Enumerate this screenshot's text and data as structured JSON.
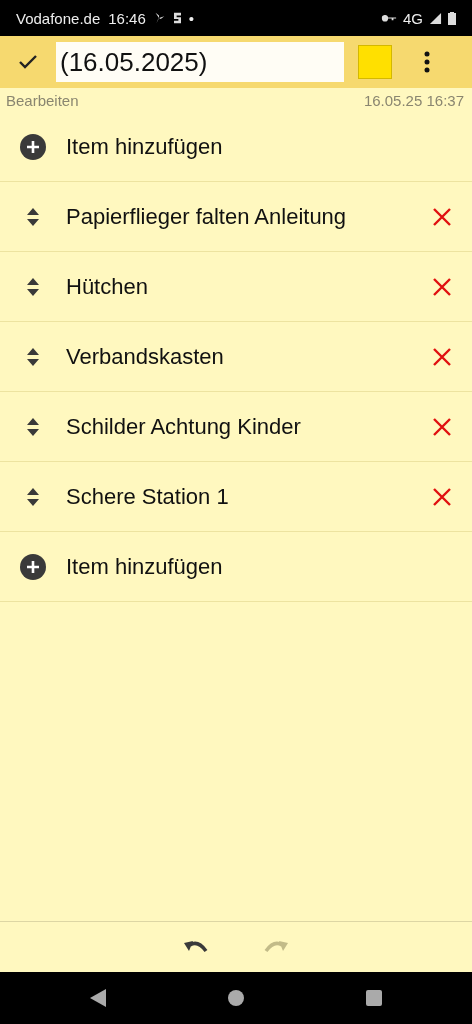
{
  "status_bar": {
    "carrier": "Vodafone.de",
    "time": "16:46",
    "dot": "•",
    "network": "4G"
  },
  "toolbar": {
    "title_value": "(16.05.2025)",
    "color": "#ffe000"
  },
  "meta": {
    "mode": "Bearbeiten",
    "timestamp": "16.05.25 16:37"
  },
  "rows": [
    {
      "kind": "add",
      "label": "Item hinzufügen"
    },
    {
      "kind": "item",
      "label": "Papierflieger falten Anleitung"
    },
    {
      "kind": "item",
      "label": "Hütchen"
    },
    {
      "kind": "item",
      "label": "Verbandskasten"
    },
    {
      "kind": "item",
      "label": "Schilder Achtung Kinder"
    },
    {
      "kind": "item",
      "label": "Schere Station 1"
    },
    {
      "kind": "add",
      "label": "Item hinzufügen"
    }
  ],
  "history": {
    "undo_disabled": false,
    "redo_disabled": true
  }
}
